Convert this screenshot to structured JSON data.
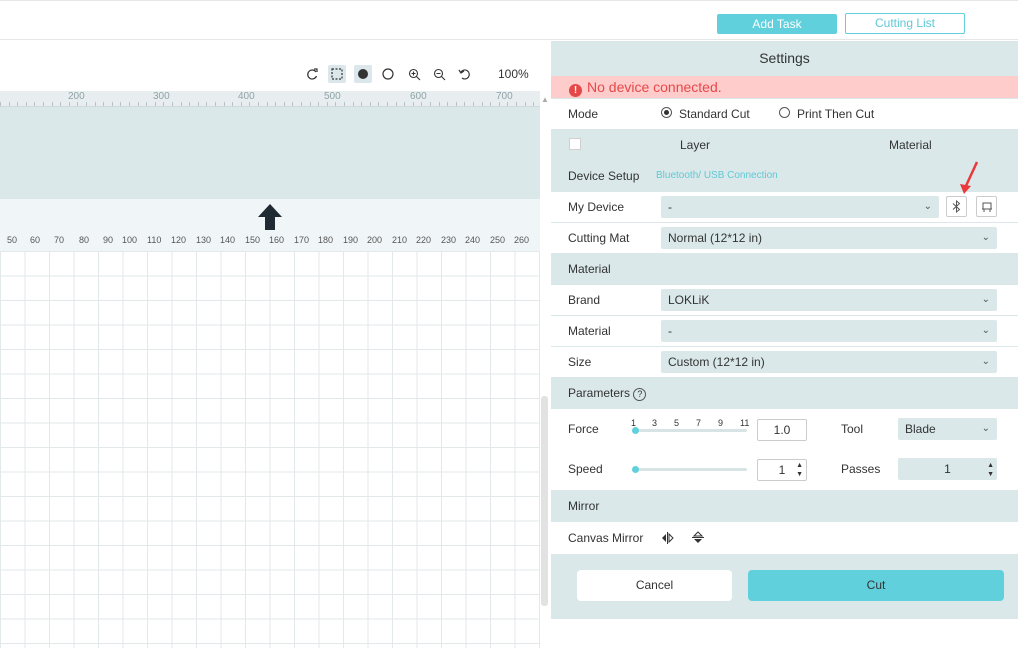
{
  "topbar": {
    "add_task": "Add Task",
    "cutting_list": "Cutting List"
  },
  "canvas": {
    "zoom": "100%",
    "top_ruler_labels": [
      "200",
      "300",
      "400",
      "500",
      "600",
      "700"
    ],
    "ruler_labels": [
      "50",
      "60",
      "70",
      "80",
      "90",
      "100",
      "110",
      "120",
      "130",
      "140",
      "150",
      "160",
      "170",
      "180",
      "190",
      "200",
      "210",
      "220",
      "230",
      "240",
      "250",
      "260"
    ]
  },
  "settings": {
    "title": "Settings",
    "alert": "No device connected.",
    "mode": {
      "label": "Mode",
      "standard": "Standard Cut",
      "print_then_cut": "Print Then Cut"
    },
    "layer_header": {
      "layer": "Layer",
      "material": "Material"
    },
    "device_setup": {
      "label": "Device Setup",
      "link": "Bluetooth/ USB Connection"
    },
    "my_device": {
      "label": "My Device",
      "value": "-"
    },
    "cutting_mat": {
      "label": "Cutting Mat",
      "value": "Normal (12*12 in)"
    },
    "material_section": "Material",
    "brand": {
      "label": "Brand",
      "value": "LOKLiK"
    },
    "material": {
      "label": "Material",
      "value": "-"
    },
    "size": {
      "label": "Size",
      "value": "Custom (12*12 in)"
    },
    "parameters": {
      "label": "Parameters",
      "help": "?"
    },
    "force": {
      "label": "Force",
      "scale": [
        "1",
        "3",
        "5",
        "7",
        "9",
        "11"
      ],
      "value": "1.0"
    },
    "tool": {
      "label": "Tool",
      "value": "Blade"
    },
    "speed": {
      "label": "Speed",
      "value": "1"
    },
    "passes": {
      "label": "Passes",
      "value": "1"
    },
    "mirror_section": "Mirror",
    "canvas_mirror": {
      "label": "Canvas Mirror"
    },
    "cancel": "Cancel",
    "cut": "Cut"
  }
}
